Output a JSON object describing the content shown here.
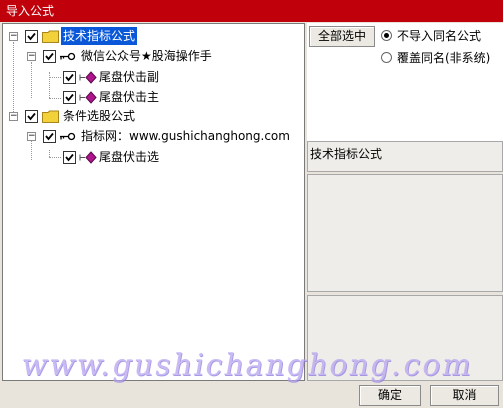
{
  "window": {
    "title": "导入公式"
  },
  "tree": [
    {
      "label": "技术指标公式",
      "kind": "folder",
      "checked": true,
      "selected": true
    },
    {
      "label": "微信公众号★股海操作手",
      "kind": "key",
      "checked": true
    },
    {
      "label": "尾盘伏击副",
      "kind": "formula",
      "checked": true
    },
    {
      "label": "尾盘伏击主",
      "kind": "formula",
      "checked": true
    },
    {
      "label": "条件选股公式",
      "kind": "folder",
      "checked": true
    },
    {
      "label": "指标网：www.gushichanghong.com",
      "kind": "key",
      "checked": true
    },
    {
      "label": "尾盘伏击选",
      "kind": "formula",
      "checked": true
    }
  ],
  "controls": {
    "select_all_label": "全部选中",
    "radio_no_import_label": "不导入同名公式",
    "radio_overwrite_label": "覆盖同名(非系统)",
    "radio_selected": "no_import"
  },
  "info": {
    "category_label": "技术指标公式"
  },
  "footer": {
    "ok_label": "确定",
    "cancel_label": "取消"
  },
  "watermark": {
    "text": "www.gushichanghong.com"
  },
  "colors": {
    "title_bar": "#c0000a",
    "selection": "#0a58d8",
    "folder": "#f2d13b",
    "formula_icon": "#b0148c"
  }
}
